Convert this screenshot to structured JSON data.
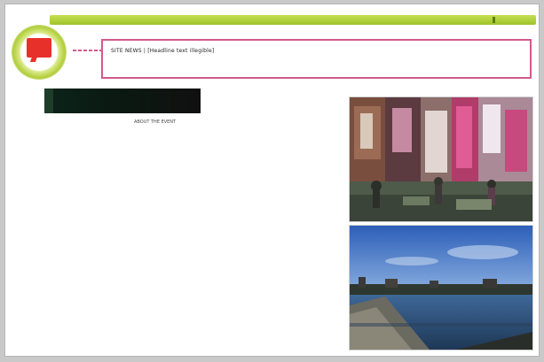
{
  "header": {
    "headline": "SITE NEWS | [Headline text illegible]",
    "accent_color": "#9ec32a",
    "highlight_color": "#d25a8e"
  },
  "badge": {
    "icon": "flag-icon",
    "color": "#e8302a"
  },
  "banner": {
    "text": "",
    "caption": "ABOUT THE EVENT"
  },
  "photos": [
    {
      "name": "market-street-photo",
      "alt": "Busy street scene with colorful shop fronts"
    },
    {
      "name": "waterfront-photo",
      "alt": "Waterfront promenade under a blue sky"
    }
  ]
}
